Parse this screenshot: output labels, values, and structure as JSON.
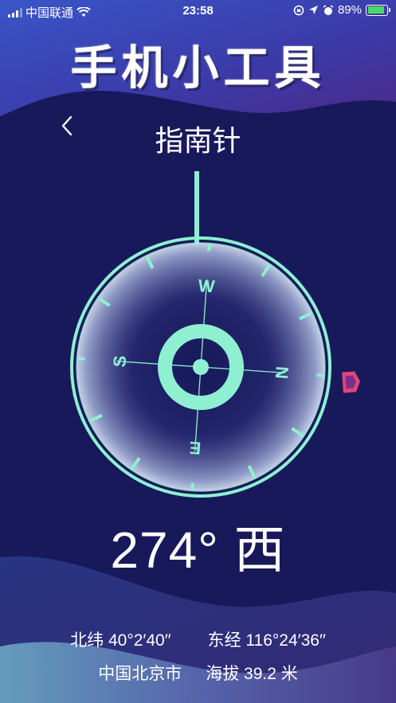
{
  "status_bar": {
    "carrier": "中国联通",
    "time": "23:58",
    "battery_percent": "89%",
    "battery_level": 0.89,
    "battery_color": "#4cd964"
  },
  "app_title": "手机小工具",
  "nav": {
    "back_icon": "chevron-left-icon",
    "page_title": "指南针"
  },
  "compass": {
    "heading_degrees": 274,
    "labels": {
      "n": "N",
      "e": "E",
      "s": "S",
      "w": "W"
    },
    "accent_color": "#8ef0d0",
    "marker_color": "#e0457b",
    "background_color": "#18195a"
  },
  "reading": {
    "degrees_text": "274°",
    "direction": "西"
  },
  "location": {
    "latitude": "北纬 40°2′40′′",
    "longitude": "东经 116°24′36′′",
    "city": "中国北京市",
    "altitude": "海拔 39.2 米"
  }
}
